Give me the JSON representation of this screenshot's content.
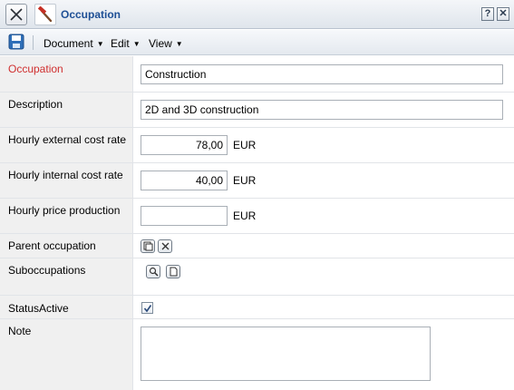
{
  "window": {
    "title": "Occupation",
    "help_label": "?",
    "close_label": "✕"
  },
  "menu": {
    "items": [
      {
        "label": "Document"
      },
      {
        "label": "Edit"
      },
      {
        "label": "View"
      }
    ]
  },
  "form": {
    "occupation": {
      "label": "Occupation",
      "value": "Construction"
    },
    "description": {
      "label": "Description",
      "value": "2D and 3D construction"
    },
    "hourly_external": {
      "label": "Hourly external cost rate",
      "value": "78,00",
      "unit": "EUR"
    },
    "hourly_internal": {
      "label": "Hourly internal cost rate",
      "value": "40,00",
      "unit": "EUR"
    },
    "hourly_price": {
      "label": "Hourly price production",
      "value": "",
      "unit": "EUR"
    },
    "parent": {
      "label": "Parent occupation"
    },
    "sub": {
      "label": "Suboccupations"
    },
    "status": {
      "label": "StatusActive",
      "checked": true
    },
    "note": {
      "label": "Note",
      "value": ""
    }
  },
  "colors": {
    "title_text": "#1e4f95",
    "required_label": "#d03030",
    "label_bg": "#f0f0f0"
  }
}
